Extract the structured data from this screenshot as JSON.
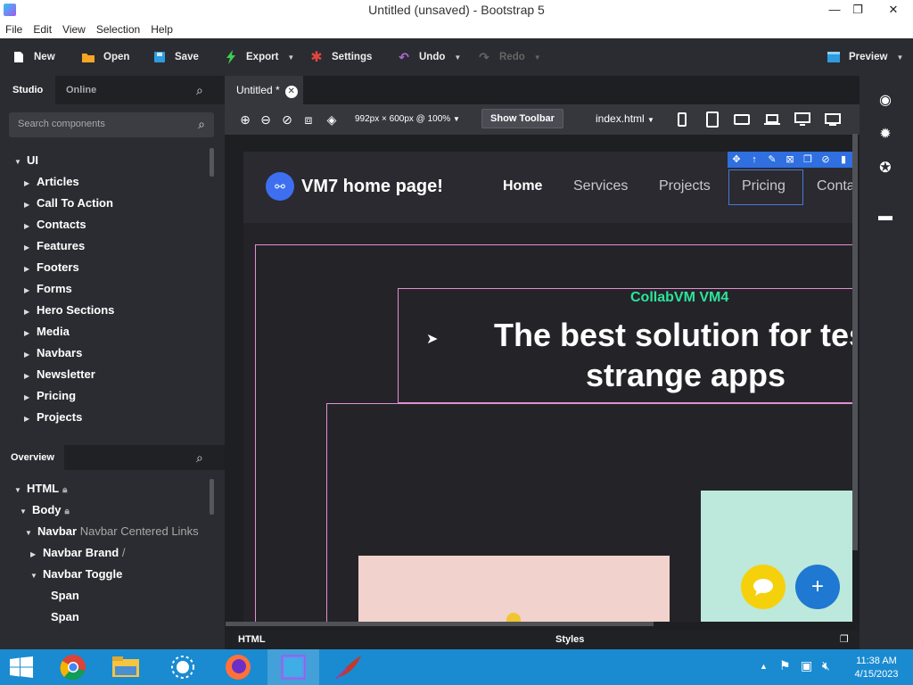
{
  "window": {
    "title": "Untitled (unsaved) - Bootstrap 5",
    "min_glyph": "—",
    "max_glyph": "❐",
    "close_glyph": "✕"
  },
  "menu": [
    "File",
    "Edit",
    "View",
    "Selection",
    "Help"
  ],
  "toolbar": {
    "new": "New",
    "open": "Open",
    "save": "Save",
    "export": "Export",
    "settings": "Settings",
    "undo": "Undo",
    "redo": "Redo",
    "preview": "Preview"
  },
  "left": {
    "tabs": [
      "Studio",
      "Online"
    ],
    "search_placeholder": "Search components",
    "tree_root": "UI",
    "tree_items": [
      "Articles",
      "Call To Action",
      "Contacts",
      "Features",
      "Footers",
      "Forms",
      "Hero Sections",
      "Media",
      "Navbars",
      "Newsletter",
      "Pricing",
      "Projects"
    ],
    "overview_title": "Overview",
    "overview": {
      "html": "HTML",
      "body": "Body",
      "navbar": "Navbar",
      "navbar_desc": "Navbar Centered Links",
      "navbar_brand": "Navbar Brand",
      "navbar_brand_suffix": "/",
      "navbar_toggle": "Navbar Toggle",
      "span1": "Span",
      "span2": "Span"
    }
  },
  "editor": {
    "doc_tab": "Untitled *",
    "size_label": "992px × 600px @ 100%",
    "show_toolbar": "Show Toolbar",
    "file_select": "index.html"
  },
  "preview": {
    "brand": "VM7 home page!",
    "nav": [
      "Home",
      "Services",
      "Projects",
      "Pricing",
      "Conta"
    ],
    "kicker": "CollabVM VM4",
    "title_line1": "The best solution for test",
    "title_line2": "strange apps"
  },
  "bottom": {
    "left_tab": "HTML",
    "right_tab": "Styles"
  },
  "taskbar": {
    "time": "11:38 AM",
    "date": "4/15/2023"
  },
  "colors": {
    "accent": "#2f6fe0",
    "kicker": "#2ee39c",
    "outline": "#e48ed6",
    "fab_yellow": "#f5d10c",
    "fab_blue": "#1f78d1",
    "taskbar": "#1a8bd1"
  }
}
